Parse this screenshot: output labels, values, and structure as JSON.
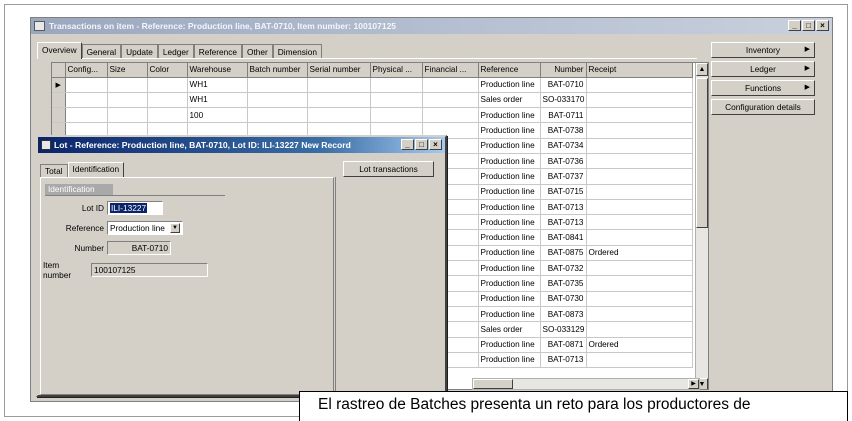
{
  "main_window": {
    "title": "Transactions on item - Reference: Production line, BAT-0710, Item number: 100107125",
    "tabs": [
      {
        "label": "Overview",
        "active": true
      },
      {
        "label": "General",
        "active": false
      },
      {
        "label": "Update",
        "active": false
      },
      {
        "label": "Ledger",
        "active": false
      },
      {
        "label": "Reference",
        "active": false
      },
      {
        "label": "Other",
        "active": false
      },
      {
        "label": "Dimension",
        "active": false
      }
    ],
    "grid": {
      "columns": [
        "Config...",
        "Size",
        "Color",
        "Warehouse",
        "Batch number",
        "Serial number",
        "Physical ...",
        "Financial ...",
        "Reference",
        "Number",
        "Receipt"
      ],
      "rows": [
        {
          "warehouse": "WH1",
          "reference": "Production line",
          "number": "BAT-0710",
          "receipt": "",
          "current": true
        },
        {
          "warehouse": "WH1",
          "reference": "Sales order",
          "number": "SO-033170",
          "receipt": ""
        },
        {
          "warehouse": "100",
          "reference": "Production line",
          "number": "BAT-0711",
          "receipt": ""
        },
        {
          "warehouse": "",
          "reference": "Production line",
          "number": "BAT-0738",
          "receipt": ""
        },
        {
          "warehouse": "",
          "reference": "Production line",
          "number": "BAT-0734",
          "receipt": ""
        },
        {
          "warehouse": "",
          "reference": "Production line",
          "number": "BAT-0736",
          "receipt": ""
        },
        {
          "warehouse": "",
          "reference": "Production line",
          "number": "BAT-0737",
          "receipt": ""
        },
        {
          "warehouse": "",
          "reference": "Production line",
          "number": "BAT-0715",
          "receipt": ""
        },
        {
          "warehouse": "",
          "reference": "Production line",
          "number": "BAT-0713",
          "receipt": ""
        },
        {
          "warehouse": "",
          "reference": "Production line",
          "number": "BAT-0713",
          "receipt": ""
        },
        {
          "warehouse": "",
          "reference": "Production line",
          "number": "BAT-0841",
          "receipt": ""
        },
        {
          "warehouse": "",
          "reference": "Production line",
          "number": "BAT-0875",
          "receipt": "Ordered"
        },
        {
          "warehouse": "",
          "reference": "Production line",
          "number": "BAT-0732",
          "receipt": ""
        },
        {
          "warehouse": "",
          "reference": "Production line",
          "number": "BAT-0735",
          "receipt": ""
        },
        {
          "warehouse": "",
          "reference": "Production line",
          "number": "BAT-0730",
          "receipt": ""
        },
        {
          "warehouse": "",
          "reference": "Production line",
          "number": "BAT-0873",
          "receipt": ""
        },
        {
          "warehouse": "",
          "reference": "Sales order",
          "number": "SO-033129",
          "receipt": ""
        },
        {
          "warehouse": "",
          "reference": "Production line",
          "number": "BAT-0871",
          "receipt": "Ordered"
        },
        {
          "warehouse": "",
          "reference": "Production line",
          "number": "BAT-0713",
          "receipt": ""
        }
      ]
    },
    "side_buttons": {
      "inventory": "Inventory",
      "ledger": "Ledger",
      "functions": "Functions",
      "configuration_details": "Configuration details"
    }
  },
  "lot_window": {
    "title": "Lot - Reference: Production line, BAT-0710, Lot ID: ILI-13227 New Record",
    "tabs": [
      {
        "label": "Total",
        "active": false
      },
      {
        "label": "Identification",
        "active": true
      }
    ],
    "lot_transactions_button": "Lot transactions",
    "group_label": "Identification",
    "fields": {
      "lot_id_label": "Lot ID",
      "lot_id_value": "ILI-13227",
      "reference_label": "Reference",
      "reference_value": "Production line",
      "number_label": "Number",
      "number_value": "BAT-0710",
      "item_number_label": "Item number",
      "item_number_value": "100107125"
    }
  },
  "caption_text": "El rastreo de Batches presenta un reto para los productores de"
}
